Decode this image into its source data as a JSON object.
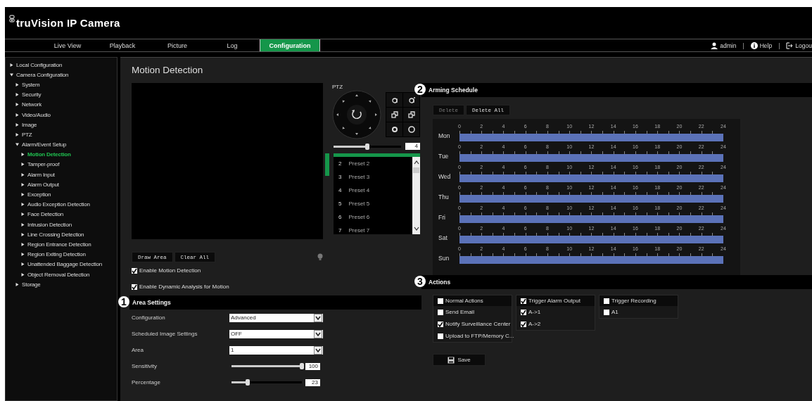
{
  "header": {
    "logo": "truVision IP Camera"
  },
  "nav": {
    "tabs": [
      {
        "label": "Live View",
        "selected": false
      },
      {
        "label": "Playback",
        "selected": false
      },
      {
        "label": "Picture",
        "selected": false
      },
      {
        "label": "Log",
        "selected": false
      },
      {
        "label": "Configuration",
        "selected": true
      }
    ],
    "separators": [
      "|",
      "|"
    ],
    "links": [
      {
        "kind": "user",
        "label": "admin"
      },
      {
        "kind": "help",
        "label": "Help"
      },
      {
        "kind": "logout",
        "label": "Logou"
      }
    ]
  },
  "sidebar": {
    "items": [
      {
        "label": "Local Configuration",
        "expanded": false,
        "selected": false
      },
      {
        "label": "Camera Configuration",
        "expanded": true,
        "selected": false,
        "children": [
          {
            "label": "System",
            "expanded": false,
            "selected": false
          },
          {
            "label": "Security",
            "expanded": false,
            "selected": false
          },
          {
            "label": "Network",
            "expanded": false,
            "selected": false
          },
          {
            "label": "Video/Audio",
            "expanded": false,
            "selected": false
          },
          {
            "label": "Image",
            "expanded": false,
            "selected": false
          },
          {
            "label": "PTZ",
            "expanded": false,
            "selected": false
          },
          {
            "label": "Alarm/Event Setup",
            "expanded": true,
            "selected": false,
            "children": [
              {
                "label": "Motion Detection",
                "expanded": false,
                "selected": true
              },
              {
                "label": "Tamper-proof",
                "expanded": false,
                "selected": false
              },
              {
                "label": "Alarm Input",
                "expanded": false,
                "selected": false
              },
              {
                "label": "Alarm Output",
                "expanded": false,
                "selected": false
              },
              {
                "label": "Exception",
                "expanded": false,
                "selected": false
              },
              {
                "label": "Audio Exception Detection",
                "expanded": false,
                "selected": false
              },
              {
                "label": "Face Detection",
                "expanded": false,
                "selected": false
              },
              {
                "label": "Intrusion Detection",
                "expanded": false,
                "selected": false
              },
              {
                "label": "Line Crossing Detection",
                "expanded": false,
                "selected": false
              },
              {
                "label": "Region Entrance Detection",
                "expanded": false,
                "selected": false
              },
              {
                "label": "Region Exiting Detection",
                "expanded": false,
                "selected": false
              },
              {
                "label": "Unattended Baggage Detection",
                "expanded": false,
                "selected": false
              },
              {
                "label": "Object Removal Detection",
                "expanded": false,
                "selected": false
              }
            ]
          },
          {
            "label": "Storage",
            "expanded": false,
            "selected": false
          }
        ]
      }
    ]
  },
  "page_title": "Motion Detection",
  "ptz": {
    "label": "PTZ",
    "speed": {
      "level": 0.5,
      "value": "4"
    },
    "presets": [
      {
        "number": "2",
        "name": "Preset 2"
      },
      {
        "number": "3",
        "name": "Preset 3"
      },
      {
        "number": "4",
        "name": "Preset 4"
      },
      {
        "number": "5",
        "name": "Preset 5"
      },
      {
        "number": "6",
        "name": "Preset 6"
      },
      {
        "number": "7",
        "name": "Preset 7"
      }
    ]
  },
  "area_buttons": [
    "Draw Area",
    "Clear All"
  ],
  "options": [
    {
      "label": "Enable Motion Detection",
      "checked": true
    },
    {
      "label": "Enable Dynamic Analysis for Motion",
      "checked": true
    }
  ],
  "area_settings": {
    "marker": "1",
    "title": "Area Settings",
    "rows": [
      {
        "kind": "select",
        "label": "Configuration",
        "value": "Advanced"
      },
      {
        "kind": "select",
        "label": "Scheduled Image Settings",
        "value": "OFF"
      },
      {
        "kind": "select",
        "label": "Area",
        "value": "1"
      },
      {
        "kind": "slider",
        "label": "Sensitivity",
        "level": 1,
        "value": "100"
      },
      {
        "kind": "slider",
        "label": "Percentage",
        "level": 0.23,
        "value": "23"
      }
    ]
  },
  "arming_schedule": {
    "marker": "2",
    "title": "Arming Schedule",
    "buttons": [
      {
        "label": "Delete",
        "disabled": true
      },
      {
        "label": "Delete All",
        "disabled": false
      }
    ],
    "days": [
      {
        "label": "Mon",
        "level": 1,
        "ticks": [
          "0",
          "2",
          "4",
          "6",
          "8",
          "10",
          "12",
          "14",
          "16",
          "18",
          "20",
          "22",
          "24"
        ]
      },
      {
        "label": "Tue",
        "level": 1,
        "ticks": [
          "0",
          "2",
          "4",
          "6",
          "8",
          "10",
          "12",
          "14",
          "16",
          "18",
          "20",
          "22",
          "24"
        ]
      },
      {
        "label": "Wed",
        "level": 1,
        "ticks": [
          "0",
          "2",
          "4",
          "6",
          "8",
          "10",
          "12",
          "14",
          "16",
          "18",
          "20",
          "22",
          "24"
        ]
      },
      {
        "label": "Thu",
        "level": 1,
        "ticks": [
          "0",
          "2",
          "4",
          "6",
          "8",
          "10",
          "12",
          "14",
          "16",
          "18",
          "20",
          "22",
          "24"
        ]
      },
      {
        "label": "Fri",
        "level": 1,
        "ticks": [
          "0",
          "2",
          "4",
          "6",
          "8",
          "10",
          "12",
          "14",
          "16",
          "18",
          "20",
          "22",
          "24"
        ]
      },
      {
        "label": "Sat",
        "level": 1,
        "ticks": [
          "0",
          "2",
          "4",
          "6",
          "8",
          "10",
          "12",
          "14",
          "16",
          "18",
          "20",
          "22",
          "24"
        ]
      },
      {
        "label": "Sun",
        "level": 1,
        "ticks": [
          "0",
          "2",
          "4",
          "6",
          "8",
          "10",
          "12",
          "14",
          "16",
          "18",
          "20",
          "22",
          "24"
        ]
      }
    ]
  },
  "actions": {
    "marker": "3",
    "title": "Actions",
    "groups": [
      {
        "header": {
          "label": "Normal Actions",
          "checked": false
        },
        "items": [
          {
            "label": "Send Email",
            "checked": false
          },
          {
            "label": "Notify Surveillance Center",
            "checked": true
          },
          {
            "label": "Upload to FTP/Memory C...",
            "checked": false
          }
        ]
      },
      {
        "header": {
          "label": "Trigger Alarm Output",
          "checked": true
        },
        "items": [
          {
            "label": "A->1",
            "checked": true
          },
          {
            "label": "A->2",
            "checked": true
          }
        ]
      },
      {
        "header": {
          "label": "Trigger Recording",
          "checked": false
        },
        "items": [
          {
            "label": "A1",
            "checked": false
          }
        ]
      }
    ]
  },
  "save_button": "Save"
}
